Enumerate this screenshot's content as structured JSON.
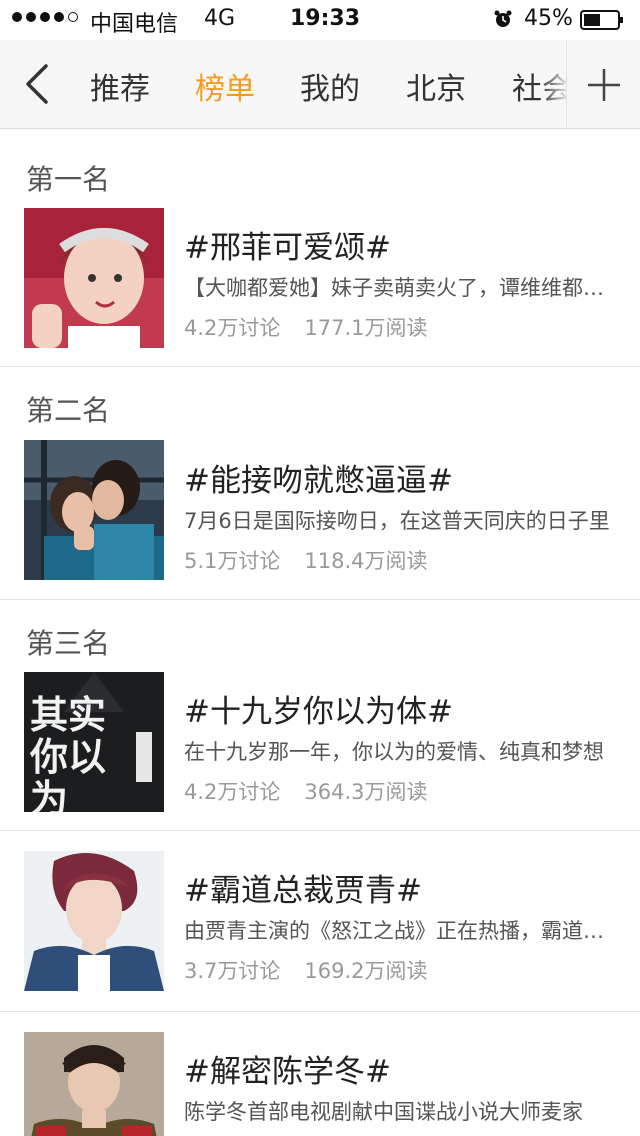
{
  "status_bar": {
    "carrier": "中国电信",
    "network": "4G",
    "time": "19:33",
    "battery": "45%"
  },
  "nav": {
    "tabs": [
      "推荐",
      "榜单",
      "我的",
      "北京",
      "社会"
    ],
    "active_tab": "榜单",
    "accent_color": "#f39c1f"
  },
  "list": [
    {
      "rank": "第一名",
      "title": "#邢菲可爱颂#",
      "desc": "【大咖都爱她】妹子卖萌卖火了，谭维维都在学她可爱颂",
      "discussions": "4.2万讨论",
      "reads": "177.1万阅读"
    },
    {
      "rank": "第二名",
      "title": "#能接吻就憋逼逼#",
      "desc": "7月6日是国际接吻日，在这普天同庆的日子里",
      "discussions": "5.1万讨论",
      "reads": "118.4万阅读"
    },
    {
      "rank": "第三名",
      "title": "#十九岁你以为体#",
      "desc": "在十九岁那一年，你以为的爱情、纯真和梦想",
      "discussions": "4.2万讨论",
      "reads": "364.3万阅读",
      "thumb_text": "其实你以为"
    },
    {
      "rank": "",
      "title": "#霸道总裁贾青#",
      "desc": "由贾青主演的《怒江之战》正在热播，霸道总裁",
      "discussions": "3.7万讨论",
      "reads": "169.2万阅读"
    },
    {
      "rank": "",
      "title": "#解密陈学冬#",
      "desc": "陈学冬首部电视剧献中国谍战小说大师麦家",
      "discussions": "",
      "reads": ""
    }
  ]
}
